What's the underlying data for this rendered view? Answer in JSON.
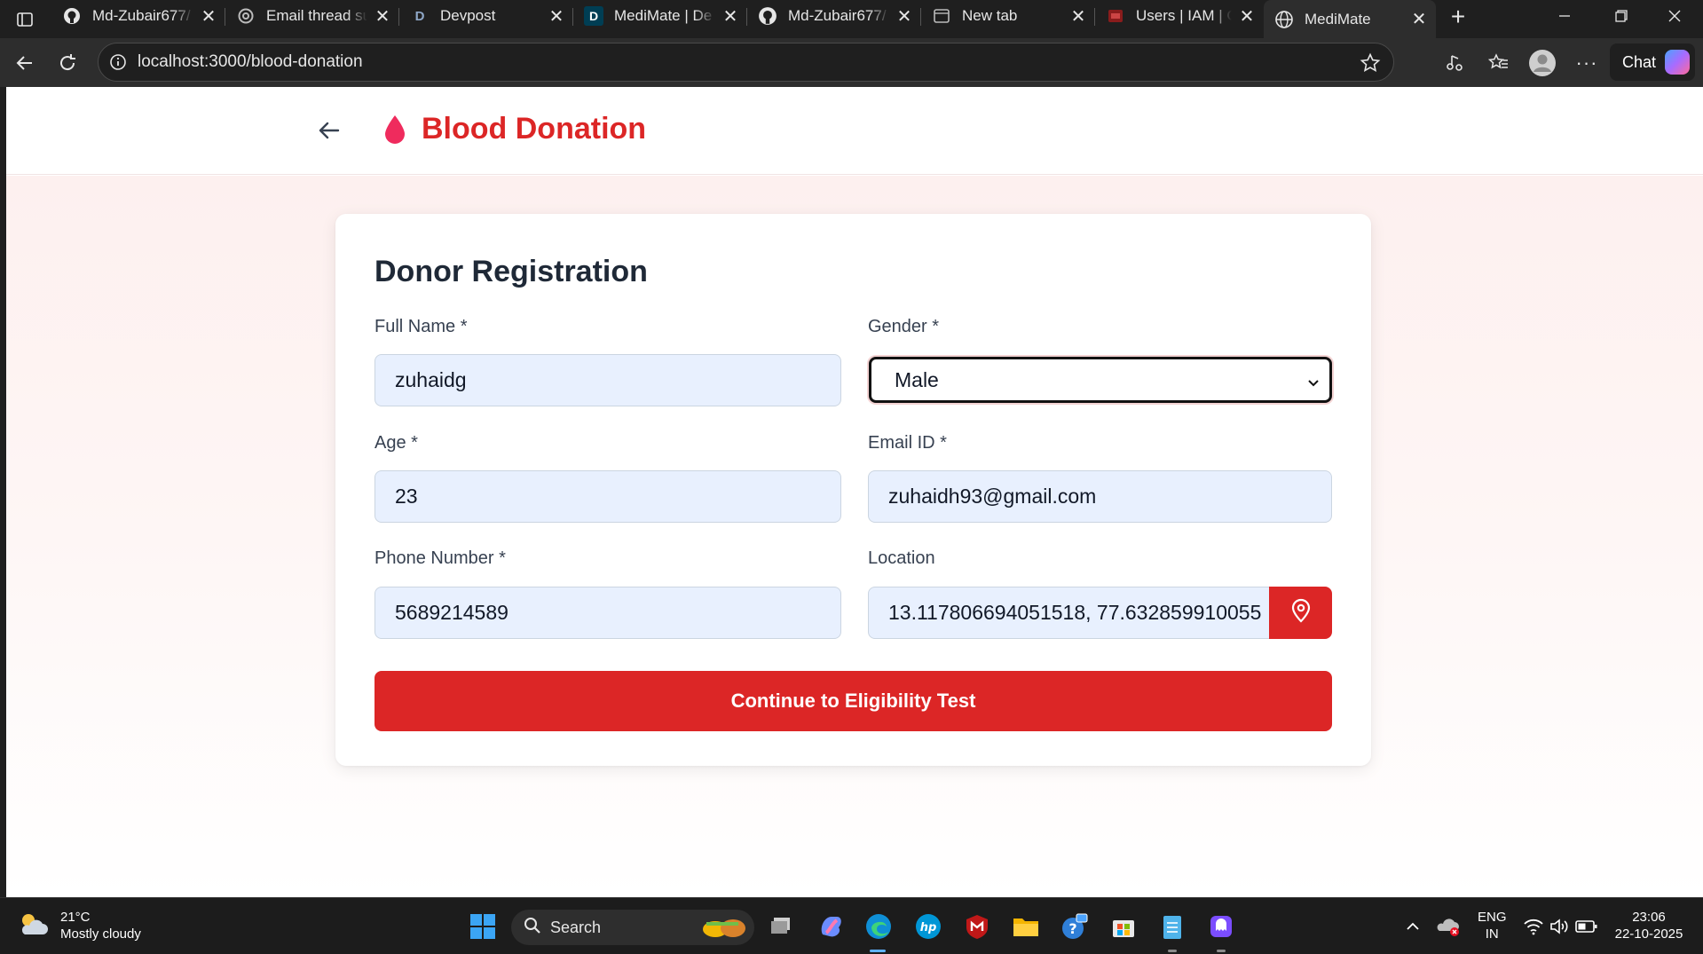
{
  "browser": {
    "tabs": [
      {
        "title": "Md-Zubair677/",
        "icon": "github-icon"
      },
      {
        "title": "Email thread su",
        "icon": "openai-icon"
      },
      {
        "title": "Devpost",
        "icon": "devpost-icon"
      },
      {
        "title": "MediMate | De",
        "icon": "devpost-icon"
      },
      {
        "title": "Md-Zubair677/",
        "icon": "github-icon"
      },
      {
        "title": "New tab",
        "icon": "newtab-icon"
      },
      {
        "title": "Users | IAM | G",
        "icon": "iam-icon"
      },
      {
        "title": "MediMate",
        "icon": "globe-icon",
        "active": true
      }
    ],
    "favicon_letter_d": "D",
    "url": "localhost:3000/blood-donation",
    "chat_label": "Chat"
  },
  "app": {
    "title": "Blood Donation",
    "accent_color": "#dc2626"
  },
  "form": {
    "heading": "Donor Registration",
    "full_name": {
      "label": "Full Name *",
      "value": "zuhaidg"
    },
    "gender": {
      "label": "Gender *",
      "value": "Male"
    },
    "age": {
      "label": "Age *",
      "value": "23"
    },
    "email": {
      "label": "Email ID *",
      "value": "zuhaidh93@gmail.com"
    },
    "phone": {
      "label": "Phone Number *",
      "value": "5689214589"
    },
    "location": {
      "label": "Location",
      "value": "13.117806694051518, 77.632859910055"
    },
    "submit_label": "Continue to Eligibility Test"
  },
  "taskbar": {
    "weather_temp": "21°C",
    "weather_desc": "Mostly cloudy",
    "search_label": "Search",
    "lang_line1": "ENG",
    "lang_line2": "IN",
    "time": "23:06",
    "date": "22-10-2025"
  }
}
